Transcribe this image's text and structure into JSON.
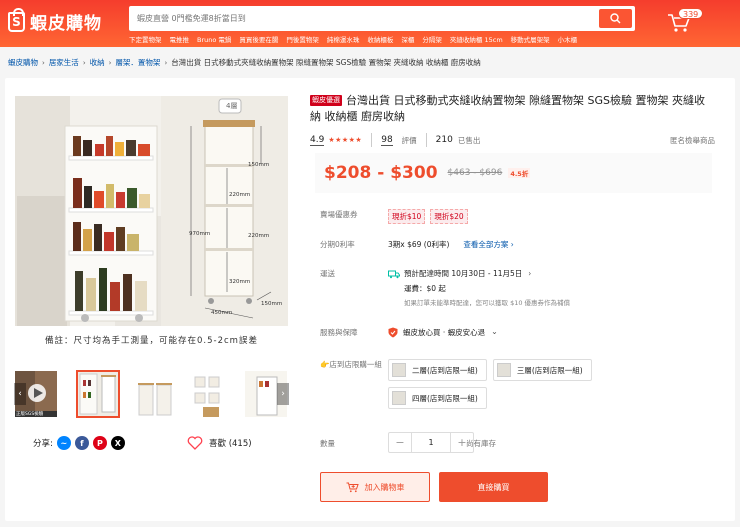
{
  "header": {
    "logo_text": "蝦皮購物",
    "logo_letter": "S",
    "search_placeholder": "蝦皮直營 0門檻免運8折當日到",
    "cart_count": "339",
    "hot_words": [
      "下定置物架",
      "電推推",
      "Bruno 電鍋",
      "買買後要在腸",
      "門後置物架",
      "純棉運水珠",
      "收納櫃板",
      "深櫃",
      "分隔架",
      "夾縫收納櫃 15cm",
      "移動式層架架",
      "小木櫃"
    ]
  },
  "breadcrumb": {
    "items": [
      "蝦皮購物",
      "居家生活",
      "收納",
      "層架．置物架"
    ],
    "current": "台灣出貨 日式移動式夾縫收納置物架 隙縫置物架 SGS檢驗 置物架 夾縫收納 收納櫃 廚房收納"
  },
  "gallery": {
    "caption": "備註：尺寸均為手工測量，可能存在0.5-2cm誤差",
    "layer_badge": "4層",
    "dimensions": [
      "150mm",
      "220mm",
      "220mm",
      "320mm",
      "970mm",
      "450mm",
      "150mm"
    ],
    "thumb_badge": "正版SGS檢驗"
  },
  "share": {
    "label": "分享:"
  },
  "likes": {
    "label": "喜歡 (415)"
  },
  "product": {
    "tag": "蝦皮優選",
    "title": "台灣出貨 日式移動式夾縫收納置物架 隙縫置物架 SGS檢驗 置物架 夾縫收納 收納櫃 廚房收納",
    "rating": "4.9",
    "reviews_count": "98",
    "reviews_label": "評價",
    "sold_count": "210",
    "sold_label": "已售出",
    "report": "匿名檢舉商品",
    "price": "$208 - $300",
    "original_price": "$463 - $696",
    "discount": "4.5折"
  },
  "coupons": {
    "label": "賣場優惠券",
    "items": [
      "現折$10",
      "現折$20"
    ]
  },
  "installment": {
    "label": "分期0利率",
    "value": "3期x $69 (0利率)",
    "link": "查看全部方案"
  },
  "shipping": {
    "label": "運送",
    "eta": "預計配達時間 10月30日 - 11月5日",
    "fee": "運費：$0 起",
    "note": "如果訂單未能準時配達，您可以獲取 $10 優惠券作為補償"
  },
  "service": {
    "label": "服務與保障",
    "value": "蝦皮放心買 · 蝦皮安心退"
  },
  "variation": {
    "label": "店到店限購一組",
    "options": [
      "二層(店到店限一組)",
      "三層(店到店限一組)",
      "四層(店到店限一組)"
    ]
  },
  "quantity": {
    "label": "數量",
    "value": "1",
    "minus": "−",
    "plus": "+",
    "stock": "尚有庫存"
  },
  "actions": {
    "add_to_cart": "加入購物車",
    "buy_now": "直接購買"
  },
  "colors": {
    "brand": "#ee4d2d",
    "header_start": "#f53d2d",
    "header_end": "#ff6633",
    "link": "#0055aa"
  }
}
